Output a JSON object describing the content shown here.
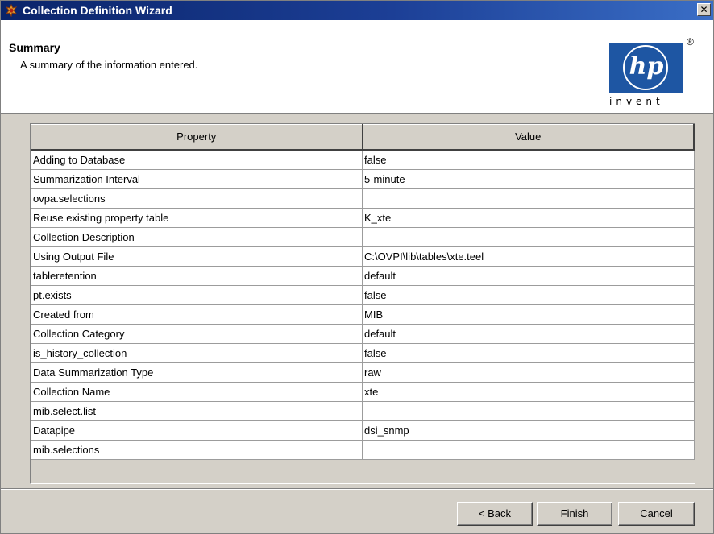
{
  "window": {
    "title": "Collection Definition Wizard",
    "close_glyph": "✕"
  },
  "header": {
    "title": "Summary",
    "subtitle": "A summary of the information entered.",
    "logo": {
      "brand": "hp",
      "tagline": "invent",
      "registered": "®"
    }
  },
  "table": {
    "columns": [
      "Property",
      "Value"
    ],
    "rows": [
      {
        "property": "Adding to Database",
        "value": "false"
      },
      {
        "property": "Summarization Interval",
        "value": "5-minute"
      },
      {
        "property": "ovpa.selections",
        "value": ""
      },
      {
        "property": "Reuse existing property table",
        "value": "K_xte"
      },
      {
        "property": "Collection Description",
        "value": ""
      },
      {
        "property": "Using Output File",
        "value": "C:\\OVPI\\lib\\tables\\xte.teel"
      },
      {
        "property": "tableretention",
        "value": "default"
      },
      {
        "property": "pt.exists",
        "value": "false"
      },
      {
        "property": "Created from",
        "value": "MIB"
      },
      {
        "property": "Collection Category",
        "value": "default"
      },
      {
        "property": "is_history_collection",
        "value": "false"
      },
      {
        "property": "Data Summarization Type",
        "value": "raw"
      },
      {
        "property": "Collection Name",
        "value": "xte"
      },
      {
        "property": "mib.select.list",
        "value": ""
      },
      {
        "property": "Datapipe",
        "value": "dsi_snmp"
      },
      {
        "property": "mib.selections",
        "value": ""
      }
    ]
  },
  "buttons": {
    "back": "< Back",
    "finish": "Finish",
    "cancel": "Cancel"
  }
}
